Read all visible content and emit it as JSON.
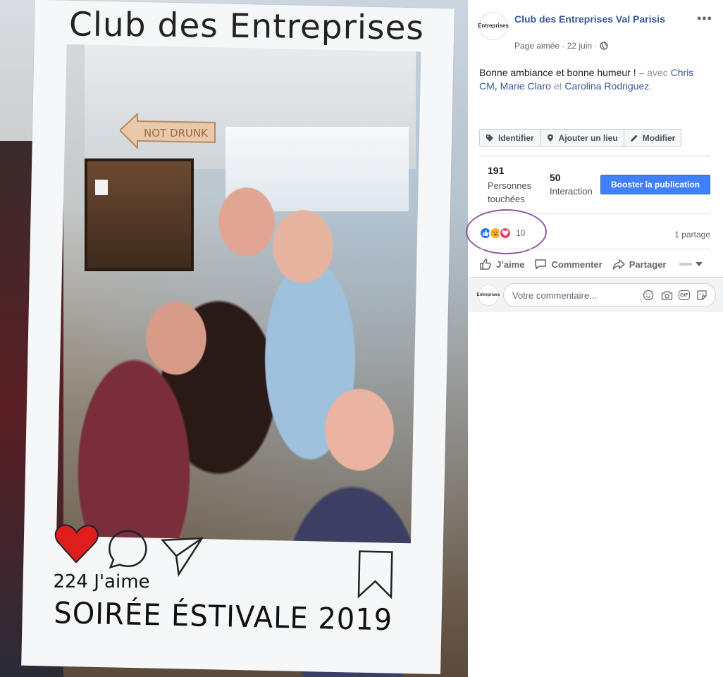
{
  "photo": {
    "frame_title": "Club des Entreprises",
    "likes_text": "224 J'aime",
    "event_text": "SOIRÉE ÉSTIVALE 2019",
    "sign_text": "NOT DRUNK"
  },
  "post": {
    "page_avatar_text": "Entreprises",
    "page_name": "Club des Entreprises Val Parisis",
    "meta": "Page aimée · 22 juin ·",
    "text_main": "Bonne ambiance et bonne humeur !",
    "text_with": "– avec",
    "tag_1": "Chris CM",
    "tag_2": "Marie Claro",
    "text_and": "et",
    "tag_3": "Carolina Rodriguez",
    "text_end": "."
  },
  "tools": {
    "identify": "Identifier",
    "add_place": "Ajouter un lieu",
    "edit": "Modifier"
  },
  "stats": {
    "reach_number": "191",
    "reach_label": "Personnes touchées",
    "engagement_number": "50",
    "engagement_label": "Interactions",
    "boost": "Booster la publication"
  },
  "reactions": {
    "count": "10",
    "shares": "1 partage"
  },
  "actions": {
    "like": "J’aime",
    "comment": "Commenter",
    "share": "Partager"
  },
  "comment": {
    "placeholder": "Votre commentaire...",
    "gif_label": "GIF"
  },
  "colors": {
    "link": "#385898",
    "boost": "#4080ff",
    "highlight": "#8e5ba6"
  }
}
